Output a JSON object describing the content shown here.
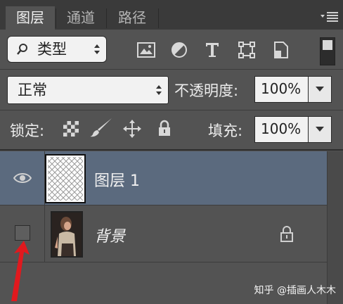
{
  "tabs": [
    {
      "label": "图层",
      "active": true
    },
    {
      "label": "通道",
      "active": false
    },
    {
      "label": "路径",
      "active": false
    }
  ],
  "filter": {
    "kind_label": "类型",
    "icons": [
      "image-filter-icon",
      "adjustment-filter-icon",
      "type-filter-icon",
      "shape-filter-icon",
      "smart-object-filter-icon",
      "filter-toggle-icon"
    ]
  },
  "blend": {
    "mode": "正常",
    "opacity_label": "不透明度:",
    "opacity_value": "100%"
  },
  "lock": {
    "label": "锁定:",
    "fill_label": "填充:",
    "fill_value": "100%"
  },
  "layers": [
    {
      "name": "图层 1",
      "visible": true,
      "selected": true,
      "locked": false
    },
    {
      "name": "背景",
      "visible": false,
      "selected": false,
      "locked": true
    }
  ],
  "watermark": "知乎 @插画人木木",
  "colors": {
    "panel": "#535353",
    "tabbar": "#3a3a3a",
    "selected_layer": "#5b6a7e",
    "annotation_arrow": "#e0191e"
  }
}
